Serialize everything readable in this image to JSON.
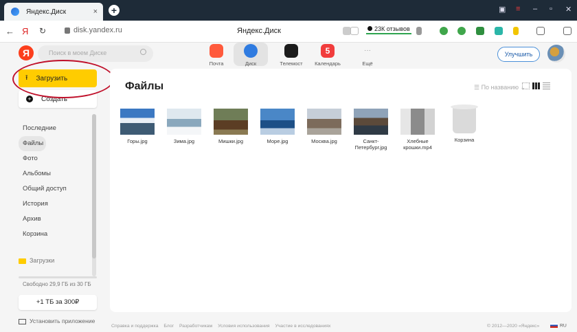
{
  "browser": {
    "tab_title": "Яндекс.Диск",
    "tab_close": "×",
    "new_tab": "+",
    "url": "disk.yandex.ru",
    "page_title": "Яндекс.Диск",
    "reviews": "23К отзывов",
    "back": "←",
    "yandex_logo_letter": "Я",
    "reload": "↻"
  },
  "app_header": {
    "logo_letter": "Я",
    "search_placeholder": "Поиск в моем Диске",
    "services": [
      {
        "label": "Почта",
        "color": "#ff5a3c"
      },
      {
        "label": "Диск",
        "color": "#2f7be0"
      },
      {
        "label": "Телемост",
        "color": "#1b1b1b"
      },
      {
        "label": "Календарь",
        "color": "#f13d3d",
        "badge": "5"
      },
      {
        "label": "Ещё",
        "color": "#999999",
        "glyph": "···"
      }
    ],
    "upgrade_label": "Улучшить"
  },
  "sidebar": {
    "upload_label": "Загрузить",
    "create_label": "Создать",
    "nav": [
      "Последние",
      "Файлы",
      "Фото",
      "Альбомы",
      "Общий доступ",
      "История",
      "Архив",
      "Корзина"
    ],
    "selected_index": 1,
    "folder_label": "Загрузки",
    "quota_text": "Свободно 29,9 ГБ из 30 ГБ",
    "buy_label": "+1 ТБ за 300₽",
    "install_label": "Установить приложение"
  },
  "main": {
    "title": "Файлы",
    "sort_label": "По названию",
    "files": [
      {
        "name": "Горы.jpg",
        "icon": "mountains-thumbnail"
      },
      {
        "name": "Зима.jpg",
        "icon": "winter-thumbnail"
      },
      {
        "name": "Мишки.jpg",
        "icon": "bears-thumbnail"
      },
      {
        "name": "Море.jpg",
        "icon": "sea-thumbnail"
      },
      {
        "name": "Москва.jpg",
        "icon": "moscow-thumbnail"
      },
      {
        "name": "Санкт-Петербург.jpg",
        "icon": "spb-thumbnail"
      },
      {
        "name": "Хлебные крошки.mp4",
        "icon": "video-thumbnail"
      },
      {
        "name": "Корзина",
        "icon": "trash-icon"
      }
    ]
  },
  "footer": {
    "links": [
      "Справка и поддержка",
      "Блог",
      "Разработчикам",
      "Условия использования",
      "Участие в исследованиях"
    ],
    "copyright": "© 2012—2020 «Яндекс»",
    "lang": "RU"
  }
}
